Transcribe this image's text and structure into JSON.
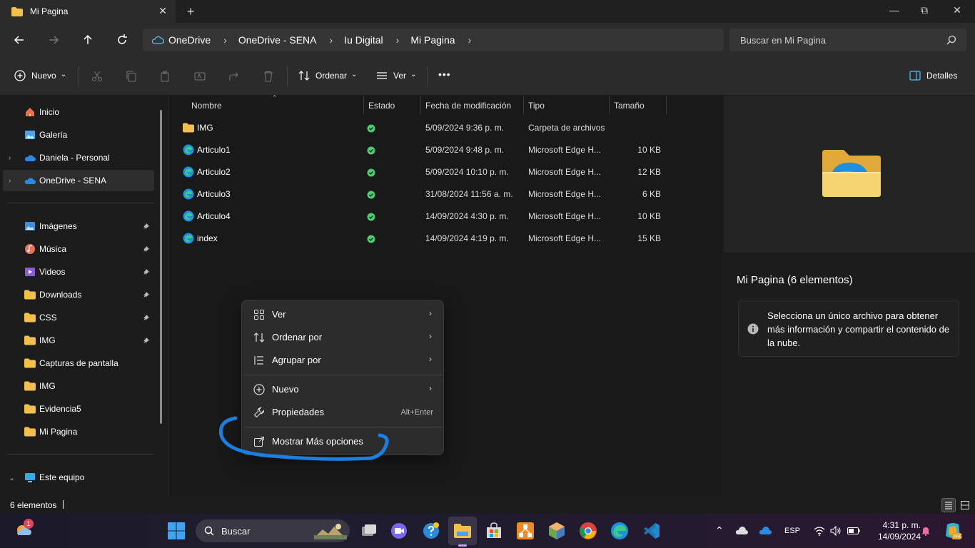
{
  "window": {
    "tab_title": "Mi Pagina",
    "close_tab": "✕",
    "new_tab": "+",
    "minimize": "—",
    "maximize": "⧉",
    "close": "✕"
  },
  "breadcrumb": [
    "OneDrive",
    "OneDrive - SENA",
    "Iu Digital",
    "Mi Pagina"
  ],
  "breadcrumb_sep": "›",
  "search": {
    "placeholder": "Buscar en Mi Pagina"
  },
  "toolbar": {
    "new_label": "Nuevo",
    "sort_label": "Ordenar",
    "view_label": "Ver",
    "more_label": "•••",
    "details_label": "Detalles",
    "chevron": "⌄"
  },
  "sidebar": {
    "pinned_top": [
      {
        "label": "Inicio",
        "icon": "home-icon"
      },
      {
        "label": "Galería",
        "icon": "gallery-icon"
      },
      {
        "label": "Daniela - Personal",
        "icon": "onedrive-icon",
        "expandable": true
      },
      {
        "label": "OneDrive - SENA",
        "icon": "onedrive-icon",
        "expandable": true,
        "selected": true
      }
    ],
    "quick_access": [
      {
        "label": "Imágenes",
        "icon": "pictures-icon",
        "pinned": true
      },
      {
        "label": "Música",
        "icon": "music-icon",
        "pinned": true
      },
      {
        "label": "Videos",
        "icon": "videos-icon",
        "pinned": true
      },
      {
        "label": "Downloads",
        "icon": "folder-icon",
        "pinned": true
      },
      {
        "label": "CSS",
        "icon": "folder-icon",
        "pinned": true
      },
      {
        "label": "IMG",
        "icon": "folder-icon",
        "pinned": true
      },
      {
        "label": "Capturas de pantalla",
        "icon": "folder-icon",
        "pinned": false
      },
      {
        "label": "IMG",
        "icon": "folder-icon",
        "pinned": false
      },
      {
        "label": "Evidencia5",
        "icon": "folder-icon",
        "pinned": false
      },
      {
        "label": "Mi Pagina",
        "icon": "folder-icon",
        "pinned": false
      }
    ],
    "this_pc": {
      "label": "Este equipo",
      "icon": "computer-icon"
    }
  },
  "columns": {
    "name": "Nombre",
    "state": "Estado",
    "date": "Fecha de modificación",
    "type": "Tipo",
    "size": "Tamaño"
  },
  "files": [
    {
      "name": "IMG",
      "icon": "folder-icon",
      "date": "5/09/2024 9:36 p. m.",
      "type": "Carpeta de archivos",
      "size": ""
    },
    {
      "name": "Articulo1",
      "icon": "edge-html-icon",
      "date": "5/09/2024 9:48 p. m.",
      "type": "Microsoft Edge H...",
      "size": "10 KB"
    },
    {
      "name": "Articulo2",
      "icon": "edge-html-icon",
      "date": "5/09/2024 10:10 p. m.",
      "type": "Microsoft Edge H...",
      "size": "12 KB"
    },
    {
      "name": "Articulo3",
      "icon": "edge-html-icon",
      "date": "31/08/2024 11:56 a. m.",
      "type": "Microsoft Edge H...",
      "size": "6 KB"
    },
    {
      "name": "Articulo4",
      "icon": "edge-html-icon",
      "date": "14/09/2024 4:30 p. m.",
      "type": "Microsoft Edge H...",
      "size": "10 KB"
    },
    {
      "name": "index",
      "icon": "edge-html-icon",
      "date": "14/09/2024 4:19 p. m.",
      "type": "Microsoft Edge H...",
      "size": "15 KB"
    }
  ],
  "details": {
    "title": "Mi Pagina (6 elementos)",
    "info": "Selecciona un único archivo para obtener más información y compartir el contenido de la nube."
  },
  "status": {
    "count": "6 elementos"
  },
  "context_menu": {
    "items": [
      {
        "label": "Ver",
        "icon": "grid-icon",
        "submenu": true
      },
      {
        "label": "Ordenar por",
        "icon": "sort-icon",
        "submenu": true
      },
      {
        "label": "Agrupar por",
        "icon": "group-icon",
        "submenu": true
      },
      {
        "label": "Nuevo",
        "icon": "plus-circle-icon",
        "submenu": true
      },
      {
        "label": "Propiedades",
        "icon": "wrench-icon",
        "shortcut": "Alt+Enter"
      },
      {
        "label": "Mostrar Más opciones",
        "icon": "expand-icon"
      }
    ],
    "arrow": "›"
  },
  "taskbar": {
    "search_label": "Buscar",
    "language": "ESP",
    "time": "4:31 p. m.",
    "date": "14/09/2024",
    "weather_badge": "1"
  },
  "colors": {
    "accent": "#4cc2ff",
    "folder": "#f2c04a",
    "status_ok": "#4ecb71",
    "scribble": "#1a7fe0"
  }
}
